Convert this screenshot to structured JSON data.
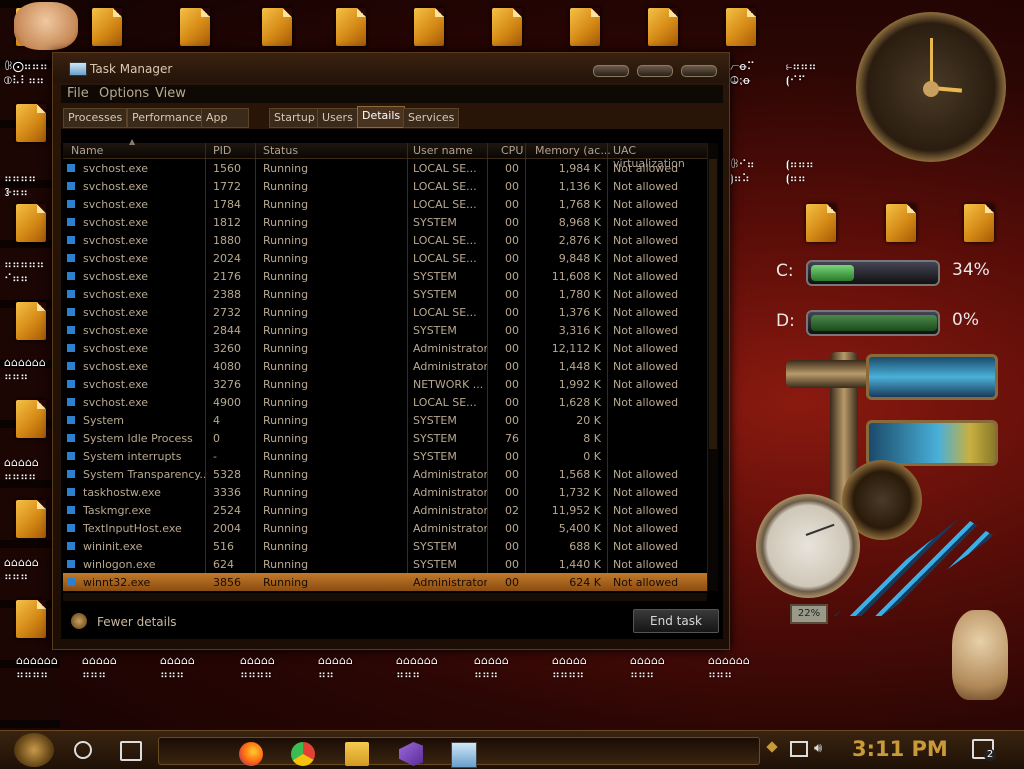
{
  "window": {
    "title": "Task Manager",
    "menu": [
      "File",
      "Options",
      "View"
    ],
    "tabs": [
      "Processes",
      "Performance",
      "App history",
      "Startup",
      "Users",
      "Details",
      "Services"
    ],
    "active_tab": "Details"
  },
  "table": {
    "columns": [
      "Name",
      "PID",
      "Status",
      "User name",
      "CPU",
      "Memory (ac...",
      "UAC virtualization"
    ],
    "rows": [
      {
        "name": "svchost.exe",
        "pid": "1560",
        "status": "Running",
        "user": "LOCAL SE...",
        "cpu": "00",
        "mem": "1,984 K",
        "uac": "Not allowed"
      },
      {
        "name": "svchost.exe",
        "pid": "1772",
        "status": "Running",
        "user": "LOCAL SE...",
        "cpu": "00",
        "mem": "1,136 K",
        "uac": "Not allowed"
      },
      {
        "name": "svchost.exe",
        "pid": "1784",
        "status": "Running",
        "user": "LOCAL SE...",
        "cpu": "00",
        "mem": "1,768 K",
        "uac": "Not allowed"
      },
      {
        "name": "svchost.exe",
        "pid": "1812",
        "status": "Running",
        "user": "SYSTEM",
        "cpu": "00",
        "mem": "8,968 K",
        "uac": "Not allowed"
      },
      {
        "name": "svchost.exe",
        "pid": "1880",
        "status": "Running",
        "user": "LOCAL SE...",
        "cpu": "00",
        "mem": "2,876 K",
        "uac": "Not allowed"
      },
      {
        "name": "svchost.exe",
        "pid": "2024",
        "status": "Running",
        "user": "LOCAL SE...",
        "cpu": "00",
        "mem": "9,848 K",
        "uac": "Not allowed"
      },
      {
        "name": "svchost.exe",
        "pid": "2176",
        "status": "Running",
        "user": "SYSTEM",
        "cpu": "00",
        "mem": "11,608 K",
        "uac": "Not allowed"
      },
      {
        "name": "svchost.exe",
        "pid": "2388",
        "status": "Running",
        "user": "SYSTEM",
        "cpu": "00",
        "mem": "1,780 K",
        "uac": "Not allowed"
      },
      {
        "name": "svchost.exe",
        "pid": "2732",
        "status": "Running",
        "user": "LOCAL SE...",
        "cpu": "00",
        "mem": "1,376 K",
        "uac": "Not allowed"
      },
      {
        "name": "svchost.exe",
        "pid": "2844",
        "status": "Running",
        "user": "SYSTEM",
        "cpu": "00",
        "mem": "3,316 K",
        "uac": "Not allowed"
      },
      {
        "name": "svchost.exe",
        "pid": "3260",
        "status": "Running",
        "user": "Administrator",
        "cpu": "00",
        "mem": "12,112 K",
        "uac": "Not allowed"
      },
      {
        "name": "svchost.exe",
        "pid": "4080",
        "status": "Running",
        "user": "Administrator",
        "cpu": "00",
        "mem": "1,448 K",
        "uac": "Not allowed"
      },
      {
        "name": "svchost.exe",
        "pid": "3276",
        "status": "Running",
        "user": "NETWORK ...",
        "cpu": "00",
        "mem": "1,992 K",
        "uac": "Not allowed"
      },
      {
        "name": "svchost.exe",
        "pid": "4900",
        "status": "Running",
        "user": "LOCAL SE...",
        "cpu": "00",
        "mem": "1,628 K",
        "uac": "Not allowed"
      },
      {
        "name": "System",
        "pid": "4",
        "status": "Running",
        "user": "SYSTEM",
        "cpu": "00",
        "mem": "20 K",
        "uac": ""
      },
      {
        "name": "System Idle Process",
        "pid": "0",
        "status": "Running",
        "user": "SYSTEM",
        "cpu": "76",
        "mem": "8 K",
        "uac": ""
      },
      {
        "name": "System interrupts",
        "pid": "-",
        "status": "Running",
        "user": "SYSTEM",
        "cpu": "00",
        "mem": "0 K",
        "uac": ""
      },
      {
        "name": "System Transparency...",
        "pid": "5328",
        "status": "Running",
        "user": "Administrator",
        "cpu": "00",
        "mem": "1,568 K",
        "uac": "Not allowed"
      },
      {
        "name": "taskhostw.exe",
        "pid": "3336",
        "status": "Running",
        "user": "Administrator",
        "cpu": "00",
        "mem": "1,732 K",
        "uac": "Not allowed"
      },
      {
        "name": "Taskmgr.exe",
        "pid": "2524",
        "status": "Running",
        "user": "Administrator",
        "cpu": "02",
        "mem": "11,952 K",
        "uac": "Not allowed"
      },
      {
        "name": "TextInputHost.exe",
        "pid": "2004",
        "status": "Running",
        "user": "Administrator",
        "cpu": "00",
        "mem": "5,400 K",
        "uac": "Not allowed"
      },
      {
        "name": "wininit.exe",
        "pid": "516",
        "status": "Running",
        "user": "SYSTEM",
        "cpu": "00",
        "mem": "688 K",
        "uac": "Not allowed"
      },
      {
        "name": "winlogon.exe",
        "pid": "624",
        "status": "Running",
        "user": "SYSTEM",
        "cpu": "00",
        "mem": "1,440 K",
        "uac": "Not allowed"
      },
      {
        "name": "winnt32.exe",
        "pid": "3856",
        "status": "Running",
        "user": "Administrator",
        "cpu": "00",
        "mem": "624 K",
        "uac": "Not allowed"
      }
    ],
    "selected_row_index": 23
  },
  "footer": {
    "fewer_details": "Fewer details",
    "end_task": "End task"
  },
  "widgets": {
    "drives": [
      {
        "label": "C:",
        "percent": "34%",
        "fill": 0.34
      },
      {
        "label": "D:",
        "percent": "0%",
        "fill": 0.0
      }
    ],
    "gauge_value": "22%"
  },
  "taskbar": {
    "time": "3:11 PM",
    "notification_count": "2",
    "pinned": [
      "firefox-icon",
      "chrome-icon",
      "file-explorer-icon",
      "visual-studio-icon",
      "task-manager-icon"
    ]
  },
  "desktop": {
    "labels": [
      "ꀝ⨀⠶⠶⠶\n⦶⠧⠇⠶⠶",
      "⦧ꝋ⠍\n⦹⁏ꝋ",
      "⥼⠶⠶⠶\n⦗⠊⠋",
      "⠶⠶⠶⠶\nꗿ⠶⠶",
      "ꀝ⠊⠶\n⦘⠶⠵",
      "⦗⠶⠶⠶\n⦗⠶⠶",
      "⠶⠶⠶⠶⠶\n⠊⠶⠶",
      "⌂⌂⌂⌂⌂⌂\n⠶⠶⠶",
      "⌂⌂⌂⌂⌂\n⠶⠶⠶⠶",
      "⌂⌂⌂⌂⌂\n⠶⠶⠶",
      "⌂⌂⌂⌂⌂⌂\n⠶⠶⠶⠶",
      "⌂⌂⌂⌂⌂\n⠶⠶⠶",
      "⌂⌂⌂⌂⌂\n⠶⠶⠶",
      "⌂⌂⌂⌂⌂\n⠶⠶⠶⠶",
      "⌂⌂⌂⌂⌂\n⠶⠶",
      "⌂⌂⌂⌂⌂⌂\n⠶⠶⠶",
      "⌂⌂⌂⌂⌂\n⠶⠶⠶",
      "⌂⌂⌂⌂⌂\n⠶⠶⠶⠶",
      "⌂⌂⌂⌂⌂\n⠶⠶⠶",
      "⌂⌂⌂⌂⌂⌂\n⠶⠶⠶"
    ]
  }
}
